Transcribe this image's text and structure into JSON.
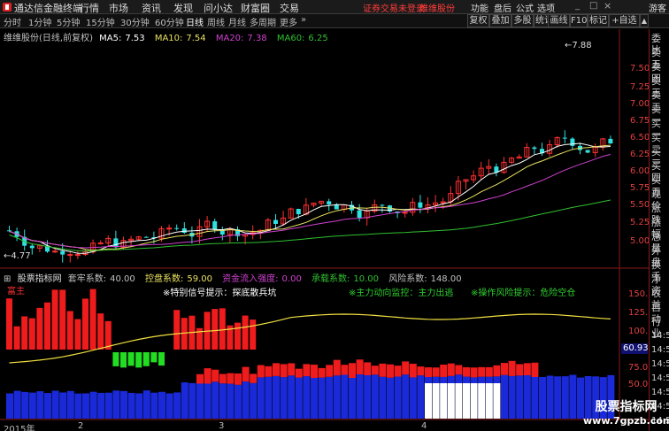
{
  "menubar": {
    "app_title": "通达信金融终端",
    "items": [
      "行情",
      "市场",
      "资讯",
      "发现",
      "问小达",
      "财富圈",
      "交易"
    ],
    "login_warning": "证券交易未登录",
    "service": "维维股份",
    "right_items": [
      "功能",
      "盘后",
      "公式",
      "选项"
    ],
    "guest": "游客"
  },
  "toolbar": {
    "periods": [
      "分时",
      "1分钟",
      "5分钟",
      "15分钟",
      "30分钟",
      "60分钟",
      "日线",
      "周线",
      "月线",
      "多周期",
      "更多"
    ],
    "active_period": "日线",
    "right_buttons": [
      "复权",
      "叠加",
      "多股",
      "统计",
      "画线",
      "F10",
      "标记",
      "+自选"
    ]
  },
  "main_chart": {
    "title": "维维股份(日线,前复权)",
    "ma": [
      {
        "label": "MA5:",
        "value": "7.53",
        "color": "#ffffff"
      },
      {
        "label": "MA10:",
        "value": "7.54",
        "color": "#e8e060"
      },
      {
        "label": "MA20:",
        "value": "7.38",
        "color": "#d040d0"
      },
      {
        "label": "MA60:",
        "value": "6.25",
        "color": "#30c030"
      }
    ],
    "price_ticks": [
      "7.50",
      "7.25",
      "7.00",
      "6.75",
      "6.50",
      "6.25",
      "6.00",
      "5.75",
      "5.50",
      "5.25",
      "5.00"
    ],
    "high_label": "7.88",
    "low_label": "4.77"
  },
  "indicator": {
    "name": "股票指标网",
    "params": [
      {
        "label": "套牢系数:",
        "value": "40.00",
        "color": "#c0c0c0"
      },
      {
        "label": "控盘系数:",
        "value": "59.00",
        "color": "#e8e060"
      },
      {
        "label": "资金流入强度:",
        "value": "0.00",
        "color": "#d040d0"
      },
      {
        "label": "承载系数:",
        "value": "10.00",
        "color": "#30c030"
      },
      {
        "label": "风险系数:",
        "value": "148.00",
        "color": "#c0c0c0"
      }
    ],
    "ticks": [
      "150.0",
      "125.0",
      "100.0",
      "75.0",
      "50.00"
    ],
    "current_value": "60.93",
    "annotations": {
      "tag": "富主",
      "hint1": "※特别信号提示：探底散兵坑",
      "hint2": "※主力动向监控：主力出逃",
      "hint3": "※操作风险提示：危险空仓"
    }
  },
  "sidebar": {
    "items": [
      "委比",
      "卖五",
      "卖四",
      "卖三",
      "卖二",
      "卖一",
      "买一",
      "买二",
      "买三",
      "买四",
      "买五",
      "现价",
      "涨跌",
      "涨幅",
      "总量",
      "外盘",
      "换手",
      "净资",
      "收益",
      "自动",
      "行业",
      "14:5",
      "14:5",
      "14:5",
      "14:5",
      "14:5",
      "14:5",
      "14:5"
    ]
  },
  "bottom": {
    "date_labels": [
      "2015年",
      "2",
      "3",
      "4"
    ],
    "watermark_title": "股票指标网",
    "watermark_url": "www.7gpzb.com"
  }
}
